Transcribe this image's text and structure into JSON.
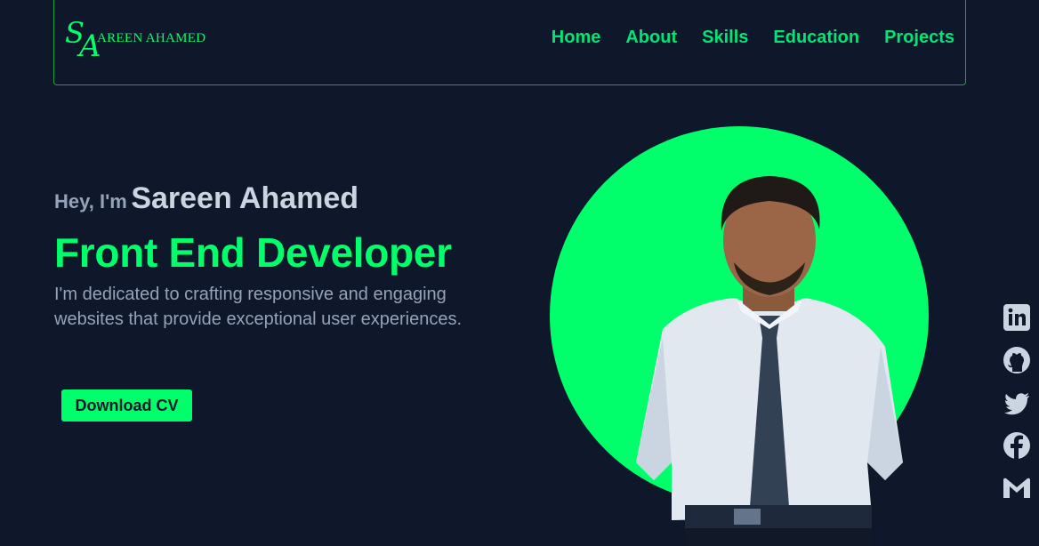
{
  "logo": {
    "monogram_s": "S",
    "monogram_a": "A",
    "text": "AREEN AHAMED"
  },
  "nav": {
    "items": [
      "Home",
      "About",
      "Skills",
      "Education",
      "Projects"
    ]
  },
  "hero": {
    "greeting": "Hey, I'm",
    "name": "Sareen Ahamed",
    "role": "Front End Developer",
    "description": "I'm dedicated to crafting responsive and engaging websites that provide exceptional user experiences.",
    "cv_button": "Download CV"
  },
  "social": [
    "linkedin-icon",
    "github-icon",
    "twitter-icon",
    "facebook-icon",
    "gmail-icon"
  ],
  "colors": {
    "background": "#0f172a",
    "accent": "#00ff6a",
    "text_muted": "#94a3b8",
    "text_light": "#cbd5e1"
  }
}
